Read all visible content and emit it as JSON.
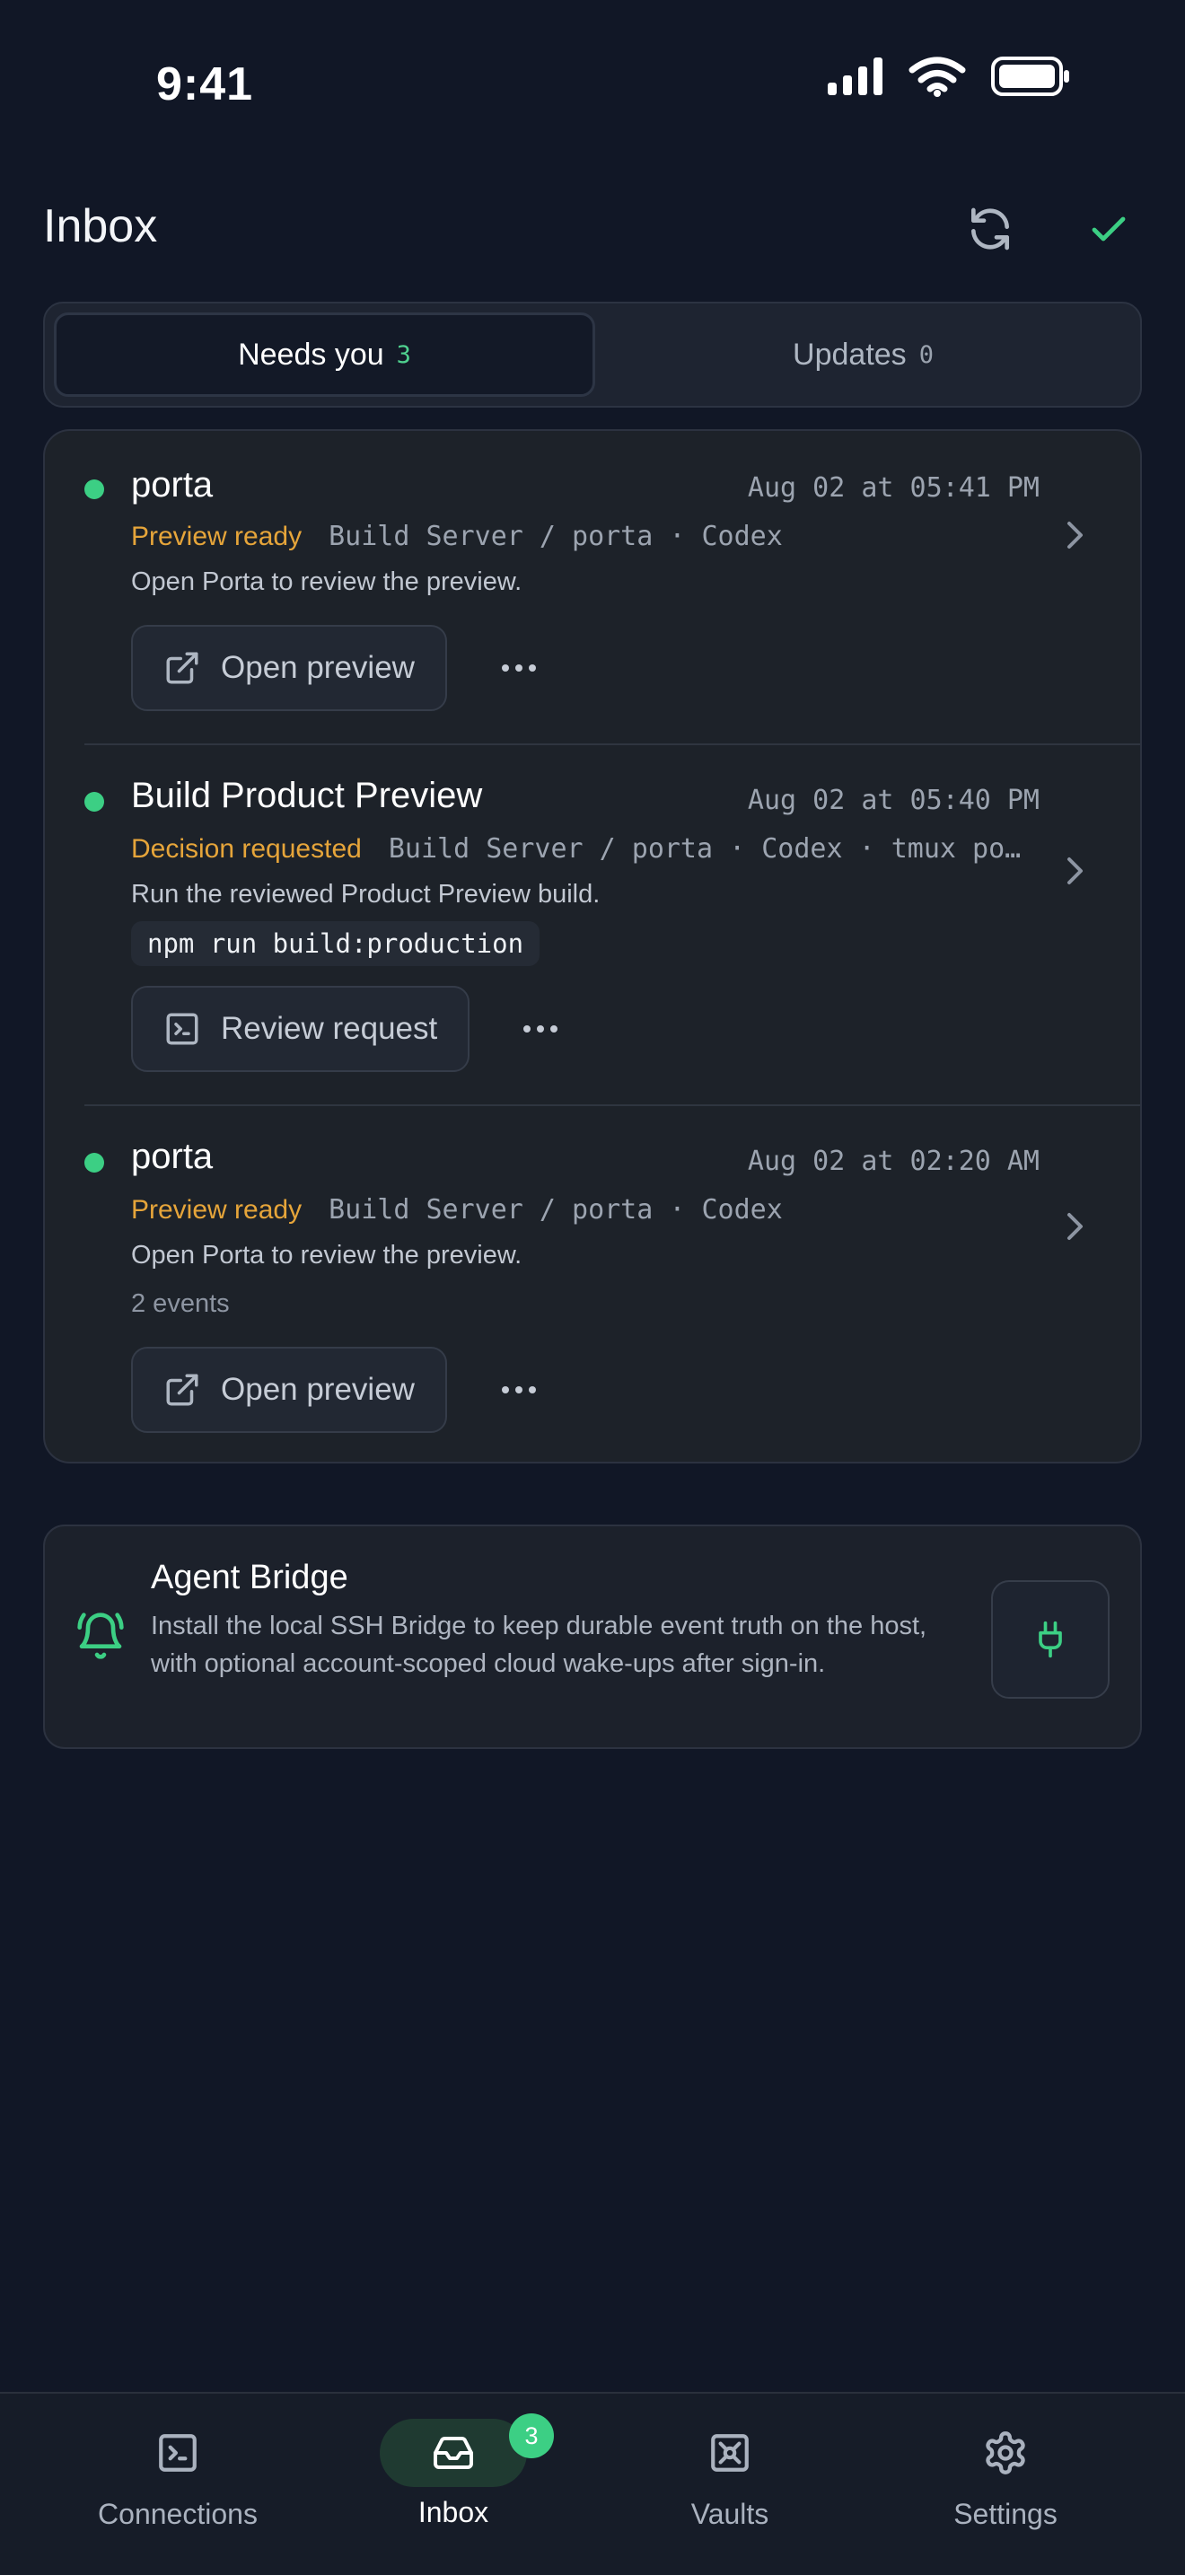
{
  "status_bar": {
    "time": "9:41"
  },
  "header": {
    "title": "Inbox",
    "refresh_icon": "refresh-icon",
    "mark_all_icon": "checkmark-icon"
  },
  "tabs": [
    {
      "label": "Needs you",
      "count": "3",
      "active": true
    },
    {
      "label": "Updates",
      "count": "0",
      "active": false
    }
  ],
  "inbox_items": [
    {
      "title": "porta",
      "timestamp": "Aug 02 at 05:41 PM",
      "status": "Preview ready",
      "meta": "Build Server / porta · Codex",
      "description": "Open Porta to review the preview.",
      "action_label": "Open preview",
      "action_icon": "external-link-icon"
    },
    {
      "title": "Build Product Preview",
      "timestamp": "Aug 02 at 05:40 PM",
      "status": "Decision requested",
      "meta": "Build Server / porta · Codex · tmux por…",
      "description": "Run the reviewed Product Preview build.",
      "command": "npm run build:production",
      "action_label": "Review request",
      "action_icon": "terminal-icon"
    },
    {
      "title": "porta",
      "timestamp": "Aug 02 at 02:20 AM",
      "status": "Preview ready",
      "meta": "Build Server / porta · Codex",
      "description": "Open Porta to review the preview.",
      "events": "2 events",
      "action_label": "Open preview",
      "action_icon": "external-link-icon"
    }
  ],
  "agent_bridge": {
    "title": "Agent Bridge",
    "description": "Install the local SSH Bridge to keep durable event truth on the host, with optional account-scoped cloud wake-ups after sign-in.",
    "icon": "bell-icon",
    "button_icon": "plug-icon"
  },
  "tabbar": [
    {
      "label": "Connections",
      "icon": "terminal-icon"
    },
    {
      "label": "Inbox",
      "icon": "inbox-icon",
      "badge": "3",
      "active": true
    },
    {
      "label": "Vaults",
      "icon": "vault-icon"
    },
    {
      "label": "Settings",
      "icon": "gear-icon"
    }
  ],
  "colors": {
    "background": "#111726",
    "accent_green": "#3ccf84",
    "status_amber": "#e6a53a",
    "card": "#1d2229"
  }
}
